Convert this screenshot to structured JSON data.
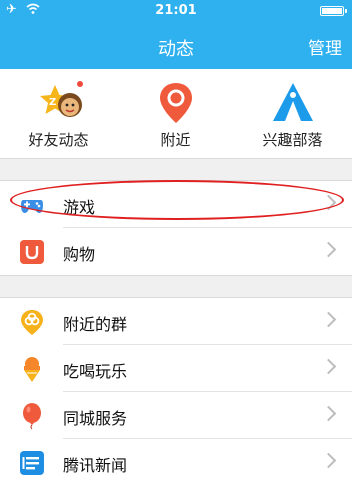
{
  "status_bar": {
    "time": "21:01",
    "icons": [
      "airplane-icon",
      "wifi-icon",
      "battery-icon"
    ]
  },
  "header": {
    "title": "动态",
    "manage_label": "管理",
    "accent_color": "#2fb0ef"
  },
  "quick_access": [
    {
      "label": "好友动态",
      "icon": "friends-feed-icon"
    },
    {
      "label": "附近",
      "icon": "location-pin-icon"
    },
    {
      "label": "兴趣部落",
      "icon": "tribe-tent-icon"
    }
  ],
  "sections": [
    {
      "items": [
        {
          "label": "游戏",
          "icon": "gamepad-icon",
          "highlighted": true
        },
        {
          "label": "购物",
          "icon": "shopping-bag-icon"
        }
      ]
    },
    {
      "items": [
        {
          "label": "附近的群",
          "icon": "nearby-groups-icon"
        },
        {
          "label": "吃喝玩乐",
          "icon": "ice-cream-icon"
        },
        {
          "label": "同城服务",
          "icon": "balloon-icon"
        },
        {
          "label": "腾讯新闻",
          "icon": "news-icon"
        }
      ]
    }
  ]
}
